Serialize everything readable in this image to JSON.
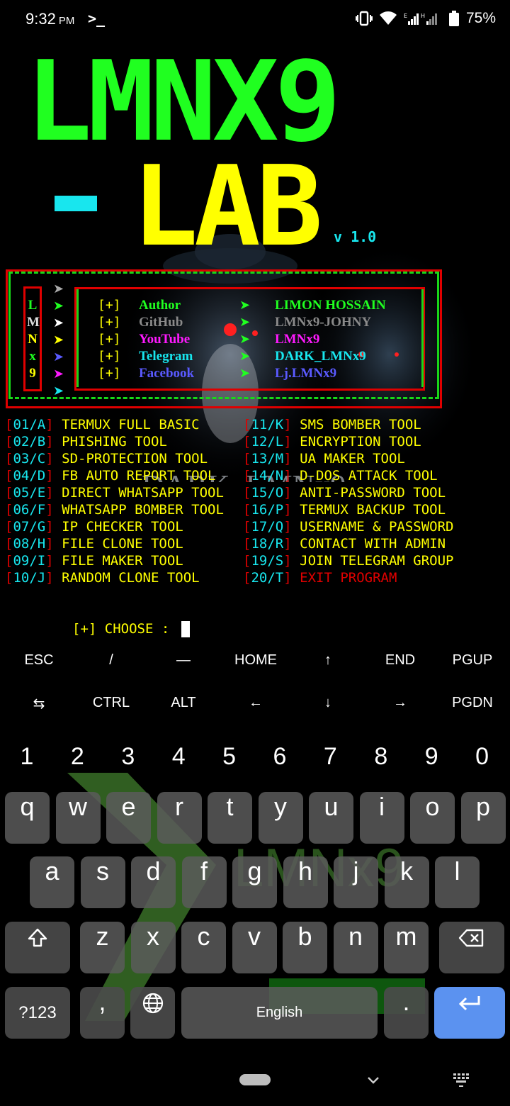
{
  "status_bar": {
    "time": "9:32",
    "ampm": "PM",
    "terminal_glyph": ">_",
    "battery_percent": "75%",
    "icons": [
      "vibrate-icon",
      "wifi-icon",
      "signal-icon",
      "battery-icon"
    ]
  },
  "banner": {
    "line1": "LMNX9",
    "line2": "LAB",
    "version": "v 1.0",
    "colors": {
      "line1": "#20ff20",
      "line2": "#ffff00",
      "accent": "#18e6ee"
    }
  },
  "watermark_text": "DARK_LMNx9",
  "side_letters": [
    "L",
    "M",
    "N",
    "x",
    "9"
  ],
  "info": [
    {
      "bracket": "[+]",
      "label": "Author",
      "label_color": "#20ff20",
      "value": "LIMON HOSSAIN",
      "value_color": "#20ff20"
    },
    {
      "bracket": "[+]",
      "label": "GitHub",
      "label_color": "#8a8a8a",
      "value": "LMNx9-JOHNY",
      "value_color": "#8a8a8a"
    },
    {
      "bracket": "[+]",
      "label": "YouTube",
      "label_color": "#ff1aff",
      "value": "LMNx9",
      "value_color": "#ff1aff"
    },
    {
      "bracket": "[+]",
      "label": "Telegram",
      "label_color": "#18e6ee",
      "value": "DARK_LMNx9",
      "value_color": "#18e6ee"
    },
    {
      "bracket": "[+]",
      "label": "Facebook",
      "label_color": "#5a5aff",
      "value": "Lj.LMNx9",
      "value_color": "#5a5aff"
    }
  ],
  "menu": {
    "left": [
      {
        "num": "01/A",
        "label": "TERMUX FULL BASIC"
      },
      {
        "num": "02/B",
        "label": "PHISHING TOOL"
      },
      {
        "num": "03/C",
        "label": "SD-PROTECTION TOOL"
      },
      {
        "num": "04/D",
        "label": "FB AUTO REPORT TOOL"
      },
      {
        "num": "05/E",
        "label": "DIRECT WHATSAPP TOOL"
      },
      {
        "num": "06/F",
        "label": "WHATSAPP BOMBER TOOL"
      },
      {
        "num": "07/G",
        "label": "IP CHECKER TOOL"
      },
      {
        "num": "08/H",
        "label": "FILE CLONE TOOL"
      },
      {
        "num": "09/I",
        "label": "FILE MAKER TOOL"
      },
      {
        "num": "10/J",
        "label": "RANDOM CLONE TOOL"
      }
    ],
    "right": [
      {
        "num": "11/K",
        "label": "SMS BOMBER TOOL"
      },
      {
        "num": "12/L",
        "label": "ENCRYPTION TOOL"
      },
      {
        "num": "13/M",
        "label": "UA MAKER TOOL"
      },
      {
        "num": "14/N",
        "label": "D-DOS ATTACK TOOL"
      },
      {
        "num": "15/O",
        "label": "ANTI-PASSWORD TOOL"
      },
      {
        "num": "16/P",
        "label": "TERMUX BACKUP TOOL"
      },
      {
        "num": "17/Q",
        "label": "USERNAME & PASSWORD"
      },
      {
        "num": "18/R",
        "label": "CONTACT WITH ADMIN"
      },
      {
        "num": "19/S",
        "label": "JOIN TELEGRAM GROUP"
      },
      {
        "num": "20/T",
        "label": "EXIT PROGRAM"
      }
    ]
  },
  "prompt": "[+] CHOOSE : ",
  "extra_keys": {
    "row1": [
      "ESC",
      "/",
      "—",
      "HOME",
      "↑",
      "END",
      "PGUP"
    ],
    "row2": [
      "⇆",
      "CTRL",
      "ALT",
      "←",
      "↓",
      "→",
      "PGDN"
    ]
  },
  "keyboard": {
    "numbers": [
      "1",
      "2",
      "3",
      "4",
      "5",
      "6",
      "7",
      "8",
      "9",
      "0"
    ],
    "row1": [
      "q",
      "w",
      "e",
      "r",
      "t",
      "y",
      "u",
      "i",
      "o",
      "p"
    ],
    "row2": [
      "a",
      "s",
      "d",
      "f",
      "g",
      "h",
      "j",
      "k",
      "l"
    ],
    "row3": [
      "z",
      "x",
      "c",
      "v",
      "b",
      "n",
      "m"
    ],
    "symbols_label": "?123",
    "comma": ",",
    "space_label": "English",
    "period": ".",
    "watermark": "LMNx9"
  }
}
